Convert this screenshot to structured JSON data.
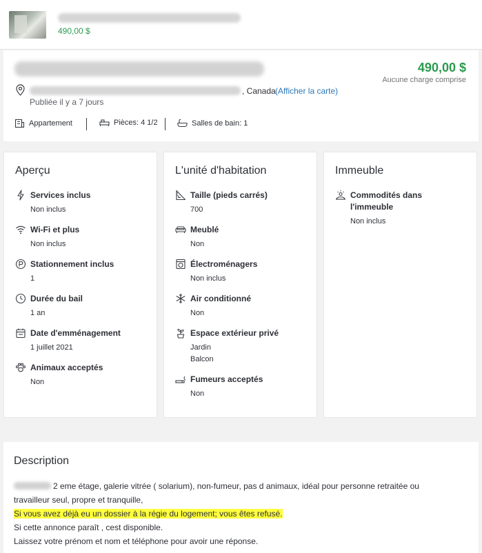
{
  "topbar": {
    "price": "490,00 $"
  },
  "header": {
    "price": "490,00 $",
    "price_note": "Aucune charge comprise",
    "country": ", Canada",
    "map_link": "(Afficher la carte)",
    "posted": "Publiée il y a 7 jours",
    "features": [
      {
        "icon": "building-icon",
        "text": "Appartement"
      },
      {
        "icon": "bed-icon",
        "text": "Pièces: 4 1/2"
      },
      {
        "icon": "bathtub-icon",
        "text": "Salles de bain: 1"
      }
    ]
  },
  "apercu": {
    "title": "Aperçu",
    "items": [
      {
        "icon": "utilities-icon",
        "label": "Services inclus",
        "value": "Non inclus"
      },
      {
        "icon": "wifi-icon",
        "label": "Wi-Fi et plus",
        "value": "Non inclus"
      },
      {
        "icon": "parking-icon",
        "label": "Stationnement inclus",
        "value": "1"
      },
      {
        "icon": "clock-icon",
        "label": "Durée du bail",
        "value": "1 an"
      },
      {
        "icon": "calendar-icon",
        "label": "Date d'emménagement",
        "value": "1 juillet 2021"
      },
      {
        "icon": "paw-icon",
        "label": "Animaux acceptés",
        "value": "Non"
      }
    ]
  },
  "unite": {
    "title": "L'unité d'habitation",
    "items": [
      {
        "icon": "ruler-icon",
        "label": "Taille (pieds carrés)",
        "values": [
          "700"
        ]
      },
      {
        "icon": "sofa-icon",
        "label": "Meublé",
        "values": [
          "Non"
        ]
      },
      {
        "icon": "washer-icon",
        "label": "Électroménagers",
        "values": [
          "Non inclus"
        ]
      },
      {
        "icon": "snowflake-icon",
        "label": "Air conditionné",
        "values": [
          "Non"
        ]
      },
      {
        "icon": "plant-icon",
        "label": "Espace extérieur privé",
        "values": [
          "Jardin",
          "Balcon"
        ]
      },
      {
        "icon": "cigarette-icon",
        "label": "Fumeurs acceptés",
        "values": [
          "Non"
        ]
      }
    ]
  },
  "immeuble": {
    "title": "Immeuble",
    "items": [
      {
        "icon": "amenities-icon",
        "label_line1": "Commodités dans",
        "label_line2": "l'immeuble",
        "value": "Non inclus"
      }
    ]
  },
  "description": {
    "title": "Description",
    "line1": "2 eme étage, galerie vitrée ( solarium), non-fumeur, pas d animaux, idéal pour personne retraitée ou",
    "line2": "travailleur seul, propre et tranquille,",
    "line3": "Si vous avez déjà eu un dossier à la régie du logement; vous êtes refusé.",
    "line4": "Si cette annonce paraît , cest disponible.",
    "line5": "Laissez votre prénom et nom et téléphone pour avoir une réponse."
  }
}
